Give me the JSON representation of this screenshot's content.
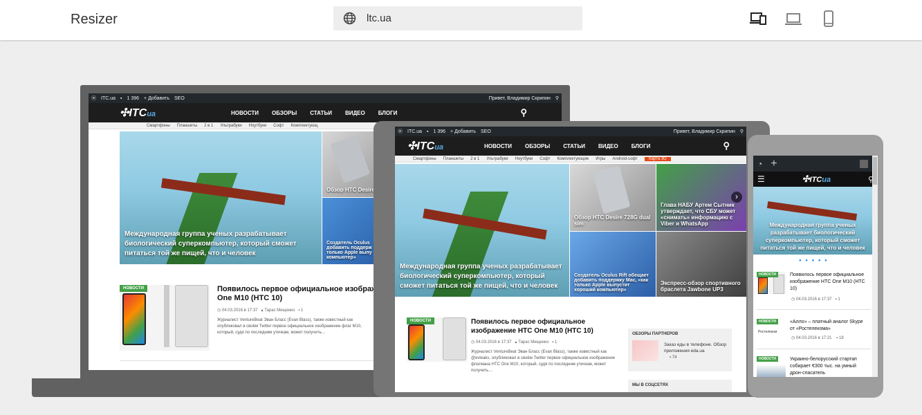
{
  "app": {
    "title": "Resizer"
  },
  "address": {
    "url": "ltc.ua"
  },
  "devices": [
    "responsive-device-icon",
    "laptop-icon",
    "phone-icon"
  ],
  "site": {
    "wp_bar": {
      "site": "ITC.ua",
      "comments": "1 396",
      "add": "Добавить",
      "seo": "SEO",
      "greeting": "Привет, Владимир Скрипин"
    },
    "logo": {
      "main": "ITC",
      "sub": "ua"
    },
    "nav": [
      "НОВОСТИ",
      "ОБЗОРЫ",
      "СТАТЬИ",
      "ВИДЕО",
      "БЛОГИ"
    ],
    "categories": [
      "Смартфоны",
      "Планшеты",
      "2 в 1",
      "Ультрабуки",
      "Ноутбуки",
      "Софт",
      "Комплектующие",
      "Игры",
      "Android-софт"
    ],
    "laptop_categories": [
      "Смартфоны",
      "Планшеты",
      "2 в 1",
      "Ультрабуки",
      "Ноутбуки",
      "Софт",
      "Комплектующ"
    ],
    "map_tag": "Карта 3G",
    "hero": {
      "title": "Международная группа ученых разрабатывает биологический суперкомпьютер, который сможет питаться той же пищей, что и человек"
    },
    "tiles": [
      {
        "caption": "Обзор HTC Desire 728G dual sim"
      },
      {
        "caption": "Глава НАБУ Артем Сытник утверждает, что СБУ может «снимать» информацию с Viber и WhatsApp"
      },
      {
        "caption": "Создатель Oculus Rift обещает добавить поддержку Mac, «как только Apple выпустит хороший компьютер»"
      },
      {
        "caption": "Экспресс-обзор спортивного браслета Jawbone UP3"
      }
    ],
    "laptop_tiles": [
      {
        "caption": "Обзор HTC Desire"
      },
      {
        "caption": "Создатель Oculus добавить поддерж только Apple выпу компьютер»"
      }
    ],
    "article": {
      "badge": "НОВОСТИ",
      "title": "Появилось первое официальное изображение HTC One M10 (HTC 10)",
      "laptop_title": "Появилось первое официальное изображе One M10 (HTC 10)",
      "date": "04.03.2016 в 17:37",
      "author": "Тарас Мищенко",
      "comments": "1",
      "desc": "Журналист VentureBeat Эван Бласс (Evan Blass), также известный как @evleaks, опубликовал в своём Twitter первое официальное изображение флагмана HTC One M10, который, судя по последним утечкам, может получить…",
      "laptop_desc": "Журналист VentureBeat Эван Бласс (Evan Blass), также известный как опубликовал в своём Twitter первое официальное изображение флаг М10, который, судя по последним утечкам, может получить…"
    },
    "partners": {
      "header": "ОБЗОРЫ ПАРТНЕРОВ",
      "text": "Заказ еды в телефоне. Обзор приложения eda.ua",
      "count": "74"
    },
    "social": {
      "header": "МЫ В СОЦСЕТЯХ"
    }
  },
  "phone": {
    "hero_title": "Международная группа ученых разрабатывает биологический суперкомпьютер, который сможет питаться той же пищей, что и человек",
    "list": [
      {
        "badge": "НОВОСТИ",
        "title": "Появилось первое официальное изображение HTC One M10 (HTC 10)",
        "date": "04.03.2016 в 17:37",
        "comments": "1"
      },
      {
        "badge": "НОВОСТИ",
        "title": "«Алло» – платный аналог Skype от «Ростелекома»",
        "date": "04.03.2016 в 17:21",
        "comments": "18",
        "thumb_text": "Ростелеком"
      },
      {
        "badge": "НОВОСТИ",
        "title": "Украино-белорусский стартап собирает €300 тыс. на умный дрон-спасатель",
        "date": "",
        "comments": ""
      }
    ]
  },
  "colors": {
    "accent_green": "#43a047",
    "map_orange": "#e64a19",
    "nav_dark": "#1d1d1d"
  }
}
